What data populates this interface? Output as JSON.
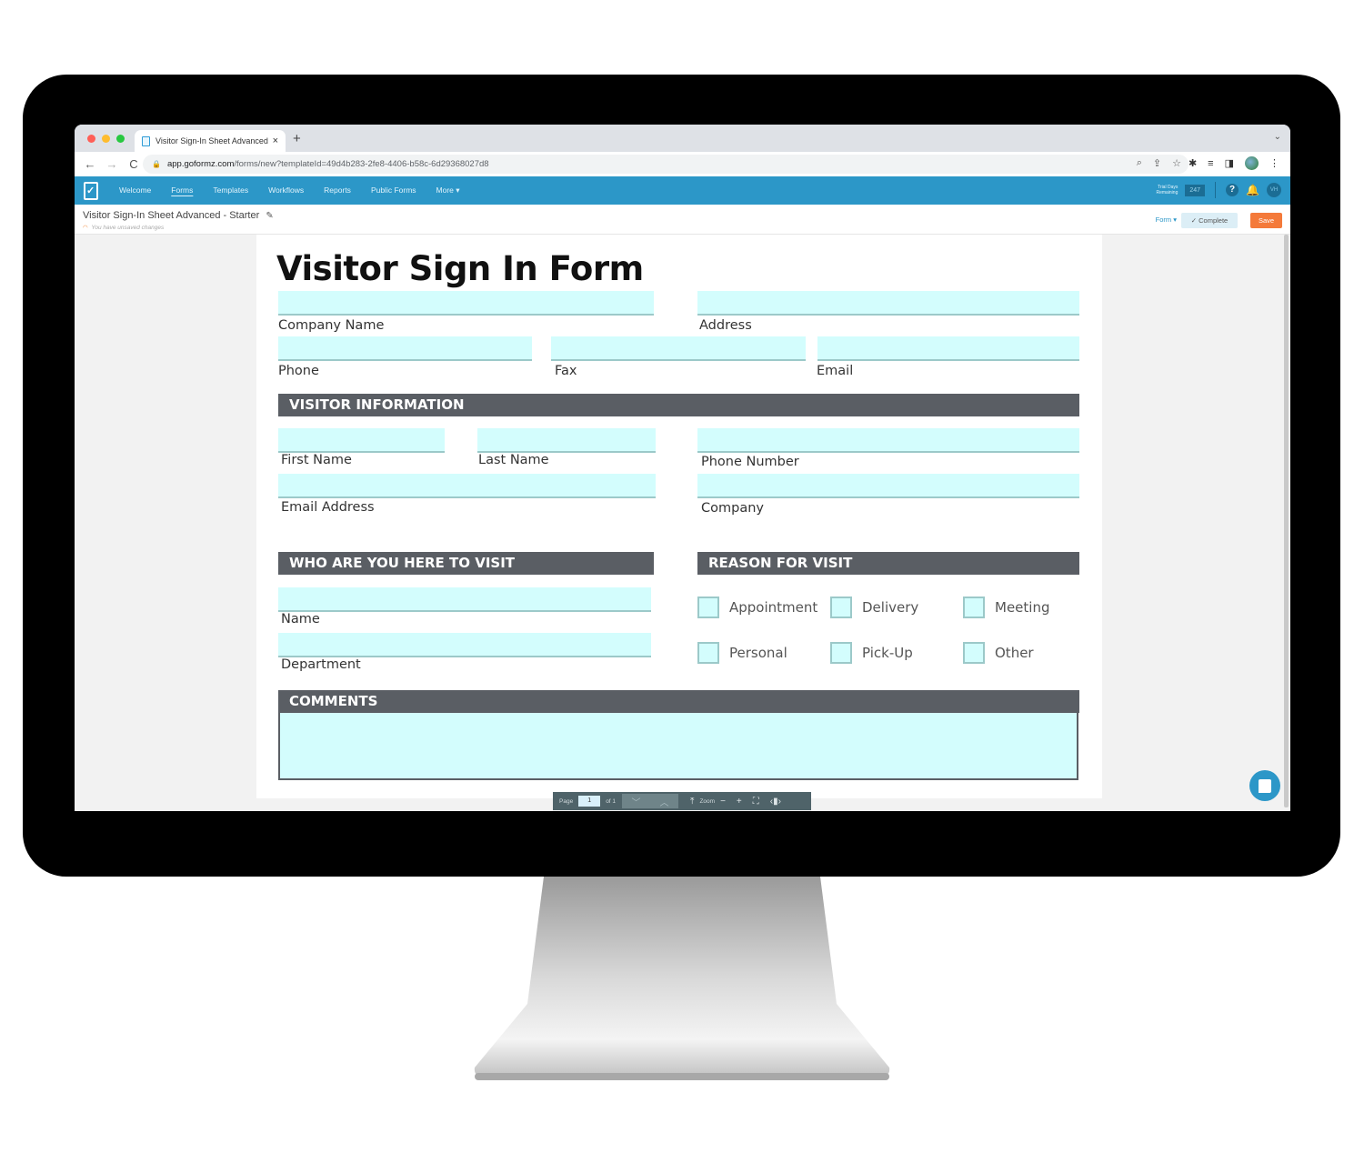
{
  "browser": {
    "tab_title": "Visitor Sign-In Sheet Advanced",
    "tab_close": "×",
    "new_tab": "+",
    "tab_menu": "⌄",
    "url_host": "app.goformz.com",
    "url_path": "/forms/new?templateId=49d4b283-2fe8-4406-b58c-6d29368027d8",
    "nav": {
      "back": "←",
      "forward": "→",
      "reload": "C"
    },
    "lock": "🔒"
  },
  "appnav": {
    "items": [
      {
        "label": "Welcome",
        "active": false
      },
      {
        "label": "Forms",
        "active": true
      },
      {
        "label": "Templates",
        "active": false
      },
      {
        "label": "Workflows",
        "active": false
      },
      {
        "label": "Reports",
        "active": false
      },
      {
        "label": "Public Forms",
        "active": false
      },
      {
        "label": "More ▾",
        "active": false
      }
    ],
    "trial_label_1": "Trial Days",
    "trial_label_2": "Remaining",
    "trial_days": "247",
    "help": "?",
    "bell": "🔔",
    "avatar_initials": "VH"
  },
  "subheader": {
    "title": "Visitor Sign-In Sheet Advanced - Starter",
    "pencil": "✎",
    "unsaved": "You have unsaved changes",
    "form_dropdown": "Form ▾",
    "complete": "✓ Complete",
    "save": "Save"
  },
  "form": {
    "title": "Visitor Sign In Form",
    "fields": {
      "company_name": "Company Name",
      "address": "Address",
      "phone": "Phone",
      "fax": "Fax",
      "email": "Email",
      "first_name": "First Name",
      "last_name": "Last Name",
      "phone_number": "Phone Number",
      "email_address": "Email Address",
      "company": "Company",
      "name": "Name",
      "department": "Department"
    },
    "sections": {
      "visitor_info": "VISITOR INFORMATION",
      "who_visit": "WHO ARE  YOU HERE TO VISIT",
      "reason": "REASON FOR VISIT",
      "comments": "COMMENTS"
    },
    "reasons": [
      "Appointment",
      "Delivery",
      "Meeting",
      "Personal",
      "Pick-Up",
      "Other"
    ]
  },
  "pagebar": {
    "page_label": "Page",
    "page_value": "1",
    "of_label": "of 1",
    "prev": "﹀",
    "next": "︿",
    "top": "⤒",
    "zoom_label": "Zoom",
    "zoom_out": "−",
    "zoom_in": "+",
    "fit": "⛶",
    "width": "‹▮›"
  },
  "colors": {
    "brand": "#2c97c8",
    "field_fill": "#d3fdfd",
    "section_bg": "#5a5e64",
    "save": "#f47a3a"
  }
}
